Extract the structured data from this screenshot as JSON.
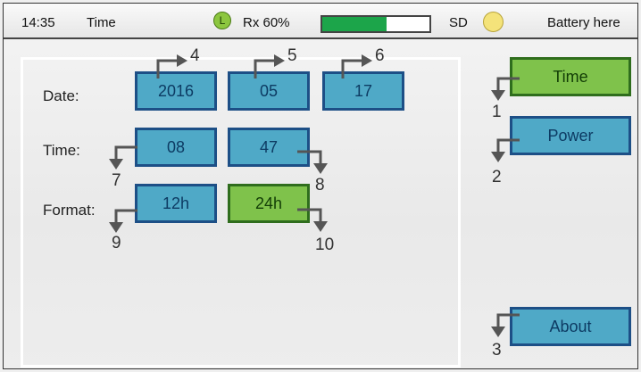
{
  "status": {
    "time": "14:35",
    "screen_title": "Time",
    "link_icon_letter": "L",
    "rx_label": "Rx 60%",
    "rx_level_percent": 60,
    "sd_label": "SD",
    "battery_label": "Battery here"
  },
  "form": {
    "date_label": "Date:",
    "time_label": "Time:",
    "format_label": "Format:",
    "year": "2016",
    "month": "05",
    "day": "17",
    "hour": "08",
    "minute": "47",
    "format_12h": "12h",
    "format_24h": "24h"
  },
  "callouts": {
    "year": "4",
    "month": "5",
    "day": "6",
    "hour": "7",
    "minute": "8",
    "format_12h": "9",
    "format_24h": "10",
    "nav_time": "1",
    "nav_power": "2",
    "nav_about": "3"
  },
  "nav": {
    "time": "Time",
    "power": "Power",
    "about": "About"
  },
  "colors": {
    "tile_blue": "#4fa9c7",
    "tile_blue_border": "#1d4f86",
    "tile_green": "#7fc24b",
    "rx_fill": "#1ca54a",
    "sd_indicator": "#f4e37a"
  }
}
